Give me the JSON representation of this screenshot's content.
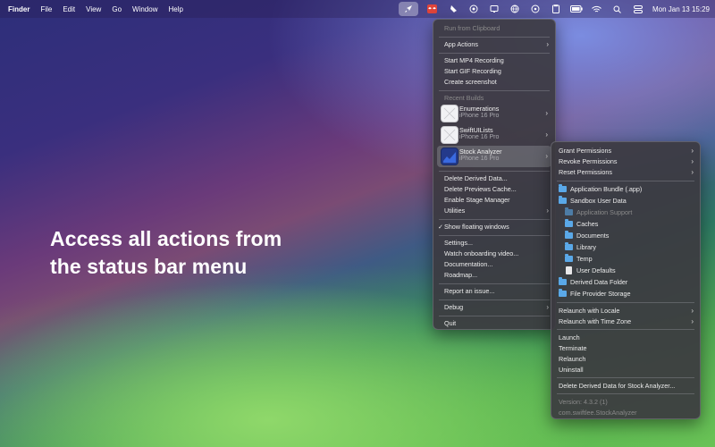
{
  "menubar": {
    "app": "Finder",
    "items": [
      "File",
      "Edit",
      "View",
      "Go",
      "Window",
      "Help"
    ],
    "clock": "Mon Jan 13  15:29"
  },
  "headline": "Access all actions from\nthe status bar menu",
  "main_menu": {
    "run_clipboard": "Run from Clipboard",
    "app_actions": "App Actions",
    "start_mp4": "Start MP4 Recording",
    "start_gif": "Start GIF Recording",
    "create_screenshot": "Create screenshot",
    "recent_builds_header": "Recent Builds",
    "builds": [
      {
        "name": "Enumerations",
        "device": "iPhone 16 Pro"
      },
      {
        "name": "SwiftUILists",
        "device": "iPhone 16 Pro"
      },
      {
        "name": "Stock Analyzer",
        "device": "iPhone 16 Pro"
      }
    ],
    "delete_derived": "Delete Derived Data...",
    "delete_previews": "Delete Previews Cache...",
    "enable_stage": "Enable Stage Manager",
    "utilities": "Utilities",
    "show_floating": "Show floating windows",
    "check": "✓",
    "settings": "Settings...",
    "watch_onboarding": "Watch onboarding video...",
    "documentation": "Documentation...",
    "roadmap": "Roadmap...",
    "report_issue": "Report an issue...",
    "debug": "Debug",
    "quit": "Quit"
  },
  "sub_menu": {
    "grant": "Grant Permissions",
    "revoke": "Revoke Permissions",
    "reset": "Reset Permissions",
    "app_bundle": "Application Bundle (.app)",
    "sandbox": "Sandbox User Data",
    "app_support": "Application Support",
    "caches": "Caches",
    "documents": "Documents",
    "library": "Library",
    "temp": "Temp",
    "user_defaults": "User Defaults",
    "derived_folder": "Derived Data Folder",
    "file_provider": "File Provider Storage",
    "relaunch_locale": "Relaunch with Locale",
    "relaunch_timezone": "Relaunch with Time Zone",
    "launch": "Launch",
    "terminate": "Terminate",
    "relaunch": "Relaunch",
    "uninstall": "Uninstall",
    "delete_derived_for": "Delete Derived Data for Stock Analyzer...",
    "version": "Version: 4.3.2 (1)",
    "bundle_id": "com.swiftlee.StockAnalyzer"
  },
  "icons": {
    "rocket": "rocket-icon",
    "chevron": "›",
    "accent": "#5aa8e8"
  }
}
